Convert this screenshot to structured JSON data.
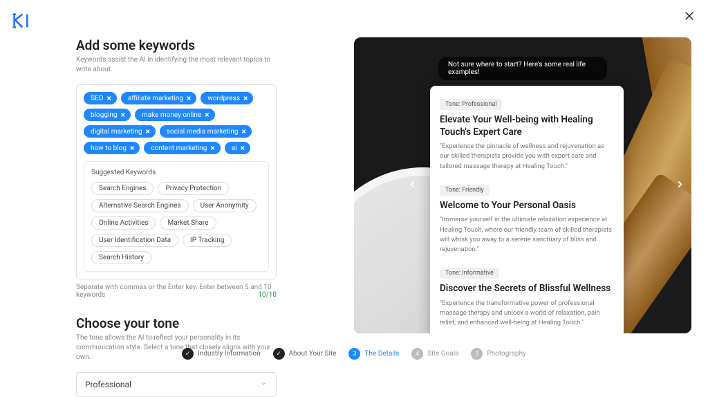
{
  "header": {
    "title": "Add some keywords",
    "subtitle": "Keywords assist the AI in identifying the most relevant topics to write about."
  },
  "keywords": [
    "SEO",
    "affiliate marketing",
    "wordpress",
    "blogging",
    "make money online",
    "digital marketing",
    "social media marketing",
    "how to blog",
    "content marketing",
    "ai"
  ],
  "suggested": {
    "title": "Suggested Keywords",
    "items": [
      "Search Engines",
      "Privacy Protection",
      "Alternative Search Engines",
      "User Anonymity",
      "Online Activities",
      "Market Share",
      "User Identification Data",
      "IP Tracking",
      "Search History"
    ]
  },
  "hint": {
    "text": "Separate with commas or the Enter key. Enter between 5 and 10 keywords",
    "count": "10/10"
  },
  "tone": {
    "title": "Choose your tone",
    "subtitle": "The tone allows the AI to reflect your personality in its communication style. Select a tone that closely aligns with your own.",
    "value": "Professional"
  },
  "preview": {
    "hint": "Not sure where to start? Here's some real life examples!",
    "examples": [
      {
        "tone": "Tone: Professional",
        "heading": "Elevate Your Well-being with Healing Touch's Expert Care",
        "body": "\"Experience the pinnacle of wellness and rejuvenation as our skilled therapists provide you with expert care and tailored massage therapy at Healing Touch.\""
      },
      {
        "tone": "Tone: Friendly",
        "heading": "Welcome to Your Personal Oasis",
        "body": "\"Immerse yourself in the ultimate relaxation experience at Healing Touch, where our friendly team of skilled therapists will whisk you away to a serene sanctuary of bliss and rejuvenation.\""
      },
      {
        "tone": "Tone: Informative",
        "heading": "Discover the Secrets of Blissful Wellness",
        "body": "\"Experience the transformative power of professional massage therapy and unlock a world of relaxation, pain relief, and enhanced well-being at Healing Touch.\""
      }
    ]
  },
  "steps": [
    {
      "label": "Industry Information",
      "state": "done",
      "mark": "✓"
    },
    {
      "label": "About Your Site",
      "state": "done",
      "mark": "✓"
    },
    {
      "label": "The Details",
      "state": "active",
      "mark": "3"
    },
    {
      "label": "Site Goals",
      "state": "pending",
      "mark": "4"
    },
    {
      "label": "Photography",
      "state": "pending",
      "mark": "5"
    }
  ]
}
